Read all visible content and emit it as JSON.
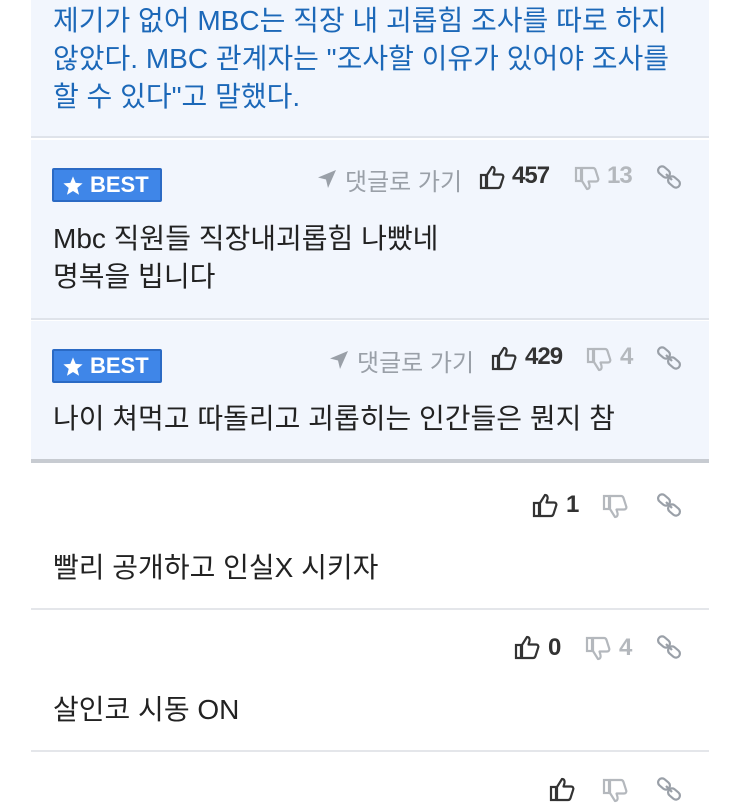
{
  "quote": {
    "text": "제기가 없어 MBC는 직장 내 괴롭힘 조사를 따로 하지 않았다. MBC 관계자는 \"조사할 이유가 있어야 조사를 할 수 있다\"고 말했다."
  },
  "best_badge": "BEST",
  "goto_label": "댓글로 가기",
  "best_comments": [
    {
      "text_line1": "Mbc 직원들 직장내괴롭힘 나빴네",
      "text_line2": "명복을 빕니다",
      "likes": "457",
      "dislikes": "13"
    },
    {
      "text_line1": "나이 쳐먹고 따돌리고 괴롭히는 인간들은 뭔지 참",
      "likes": "429",
      "dislikes": "4"
    }
  ],
  "comments": [
    {
      "text": "빨리 공개하고 인실X 시키자",
      "likes": "1",
      "dislikes": ""
    },
    {
      "text": "살인코 시동 ON",
      "likes": "0",
      "dislikes": "4"
    },
    {
      "text": "",
      "likes": "",
      "dislikes": ""
    }
  ],
  "icons": {
    "like": "thumbs-up-icon",
    "dislike": "thumbs-down-icon",
    "link": "link-icon",
    "goto": "arrow-icon",
    "badge": "star-icon"
  },
  "colors": {
    "quote_text": "#1c68b8",
    "quote_bg": "#f2f6fd",
    "badge_bg": "#3f86e8"
  }
}
